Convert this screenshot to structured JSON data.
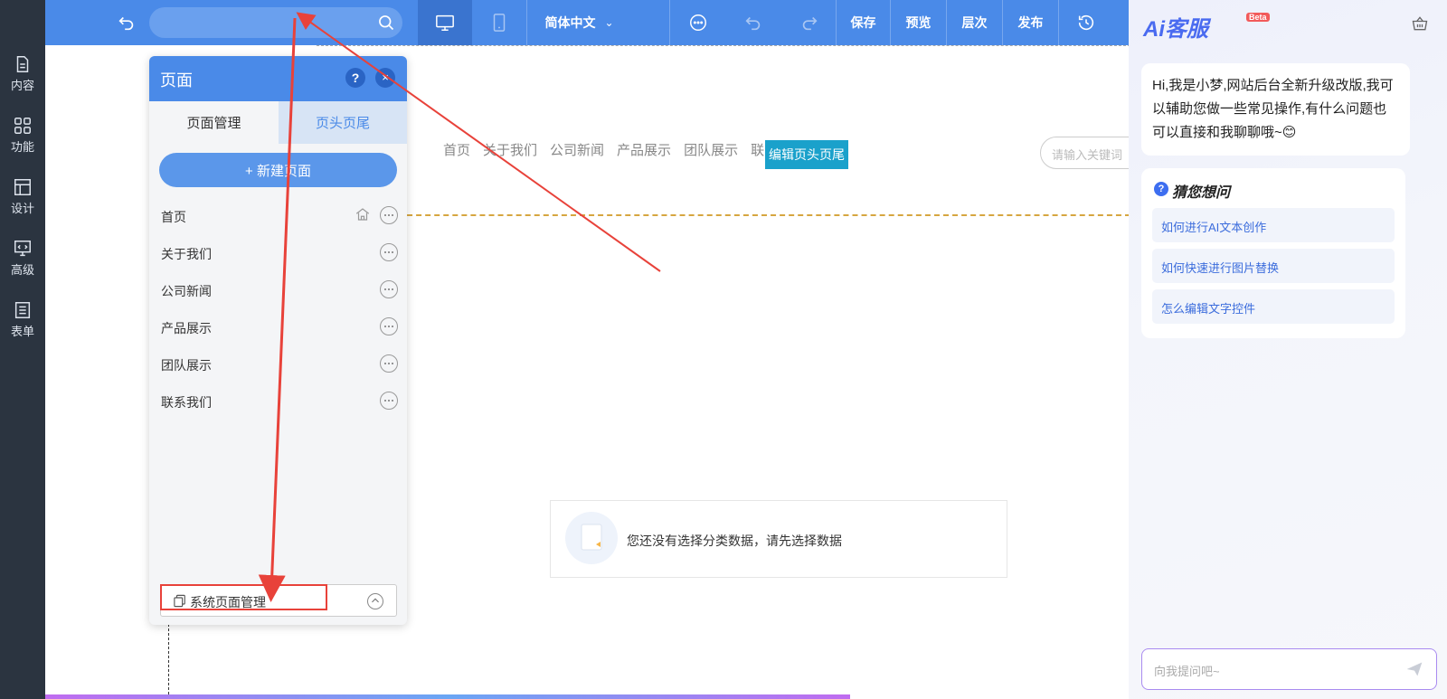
{
  "sidebar": {
    "items": [
      {
        "label": "内容",
        "icon": "document-icon"
      },
      {
        "label": "功能",
        "icon": "grid-icon"
      },
      {
        "label": "设计",
        "icon": "layout-icon"
      },
      {
        "label": "高级",
        "icon": "code-monitor-icon"
      },
      {
        "label": "表单",
        "icon": "form-list-icon"
      }
    ]
  },
  "toolbar": {
    "language": "简体中文",
    "save_label": "保存",
    "preview_label": "预览",
    "layers_label": "层次",
    "publish_label": "发布"
  },
  "canvas": {
    "nav_items": [
      "首页",
      "关于我们",
      "公司新闻",
      "产品展示",
      "团队展示",
      "联"
    ],
    "edit_header_label": "编辑页头页尾",
    "search_placeholder": "请输入关键词",
    "empty_message": "您还没有选择分类数据，请先选择数据"
  },
  "page_panel": {
    "title": "页面",
    "help": "?",
    "close": "×",
    "tab_page_mgmt": "页面管理",
    "tab_header_footer": "页头页尾",
    "new_page_label": "+ 新建页面",
    "pages": [
      {
        "label": "首页",
        "is_home": true
      },
      {
        "label": "关于我们",
        "is_home": false
      },
      {
        "label": "公司新闻",
        "is_home": false
      },
      {
        "label": "产品展示",
        "is_home": false
      },
      {
        "label": "团队展示",
        "is_home": false
      },
      {
        "label": "联系我们",
        "is_home": false
      }
    ],
    "system_pages_label": "系统页面管理"
  },
  "ai_panel": {
    "logo": "Ai客服",
    "beta": "Beta",
    "greeting": "Hi,我是小梦,网站后台全新升级改版,我可以辅助您做一些常见操作,有什么问题也可以直接和我聊聊哦~😊",
    "suggest_title": "猜您想问",
    "suggestions": [
      "如何进行AI文本创作",
      "如何快速进行图片替换",
      "怎么编辑文字控件"
    ],
    "input_placeholder": "向我提问吧~"
  },
  "colors": {
    "toolbar_blue": "#4a8ae8",
    "sidebar_dark": "#2b3440",
    "annotation_red": "#e8423a"
  }
}
